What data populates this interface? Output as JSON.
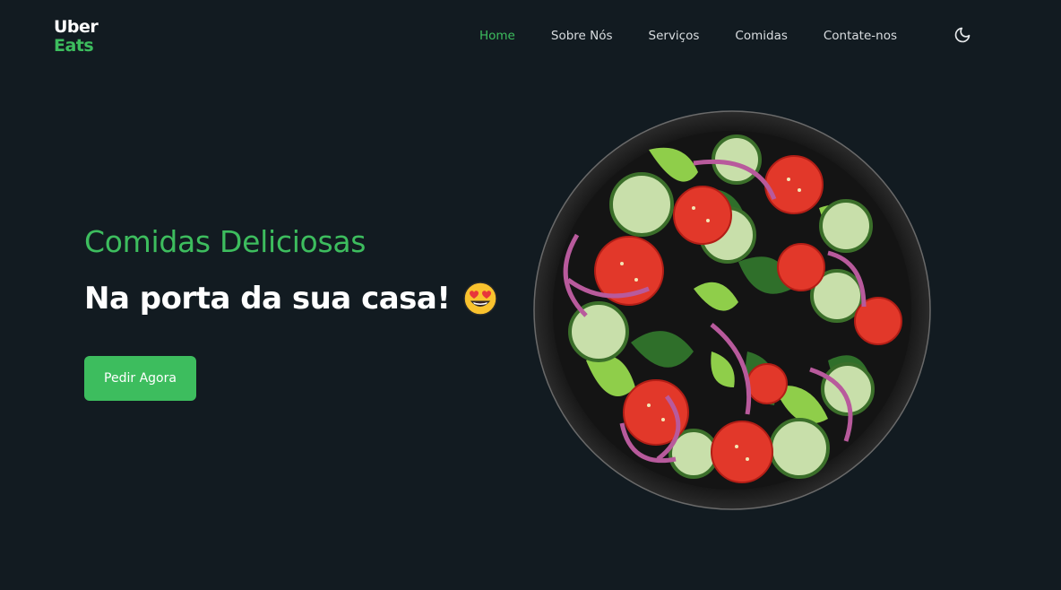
{
  "header": {
    "logo": {
      "line1": "Uber",
      "line2": "Eats"
    },
    "nav": [
      {
        "label": "Home",
        "active": true
      },
      {
        "label": "Sobre Nós",
        "active": false
      },
      {
        "label": "Serviços",
        "active": false
      },
      {
        "label": "Comidas",
        "active": false
      },
      {
        "label": "Contate-nos",
        "active": false
      }
    ],
    "theme_toggle_icon": "moon-icon"
  },
  "hero": {
    "title": "Comidas Deliciosas",
    "subtitle": "Na porta da sua casa!",
    "subtitle_emoji": "heart-eyes-emoji",
    "cta_label": "Pedir Agora",
    "image": "salad-bowl-image"
  },
  "colors": {
    "background": "#121b21",
    "accent": "#3dbd5e",
    "text": "#ffffff"
  }
}
